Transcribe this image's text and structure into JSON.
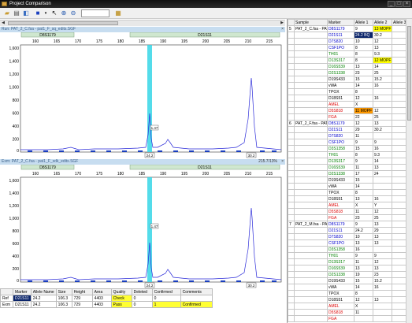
{
  "window": {
    "title": "Project Comparison"
  },
  "toolbar": {
    "zoom_value": ""
  },
  "plot1": {
    "header": "Run: PAT_2_C.fsa - pat1_F_sq_edits.SGF",
    "marker_labels": [
      "D8S1179",
      "D21S11"
    ],
    "x_ticks": [
      "160",
      "165",
      "170",
      "175",
      "180",
      "185",
      "190",
      "195",
      "200",
      "205",
      "210",
      "215"
    ],
    "y_ticks": [
      "1,600",
      "1,400",
      "1,200",
      "1,000",
      "800",
      "600",
      "400",
      "200",
      "0"
    ],
    "peak_label": "1.47",
    "allele_labels": [
      "24.2",
      "30.2"
    ]
  },
  "plot2": {
    "header": "Exm: PAT_2_C.fsa - pat1_F_sdk_edits.SGF",
    "header_right": "215.7/13%",
    "marker_labels": [
      "D8S1179",
      "D21S11"
    ],
    "x_ticks": [
      "160",
      "165",
      "170",
      "175",
      "180",
      "185",
      "190",
      "195",
      "200",
      "205",
      "210",
      "215"
    ],
    "y_ticks": [
      "1,600",
      "1,400",
      "1,200",
      "1,000",
      "800",
      "600",
      "400",
      "200",
      "0"
    ],
    "peak_label": "1.47",
    "allele_labels": [
      "24.2",
      "30.2"
    ]
  },
  "bottom_table": {
    "headers": [
      "",
      "Marker",
      "Allele Name",
      "Size",
      "Height",
      "Area",
      "Quality",
      "Deleted",
      "Confirmed",
      "Comments"
    ],
    "rows": [
      [
        "Ref",
        "D21S11",
        "24.2",
        "106.3",
        "729",
        "4403",
        "Check",
        "0",
        "0",
        ""
      ],
      [
        "Exm",
        "D21S11",
        "24.2",
        "106.3",
        "729",
        "4403",
        "Pass",
        "0",
        "1",
        "Confirmed"
      ]
    ]
  },
  "right_table": {
    "headers": [
      "",
      "Sample",
      "Marker",
      "Allele 1",
      "Allele 2",
      "Allele 3"
    ],
    "groups": [
      {
        "num": "5",
        "sample": "PAT_2_C.fsa - PAT",
        "rows": [
          {
            "m": "D8S1179",
            "c": "#0000cc",
            "a1": "9",
            "a2": "13 MOPF",
            "a2bg": "#ffff00"
          },
          {
            "m": "D21S11",
            "c": "#0000cc",
            "a1": "24.2 BQ",
            "a1bg": "#0a246a",
            "a1c": "#ffffff",
            "a2": "30.2"
          },
          {
            "m": "D7S820",
            "c": "#0000cc",
            "a1": "10",
            "a2": "12"
          },
          {
            "m": "CSF1PO",
            "c": "#0000cc",
            "a1": "8",
            "a2": "13"
          },
          {
            "m": "TH01",
            "c": "#008000",
            "a1": "8",
            "a2": "9.3"
          },
          {
            "m": "D13S317",
            "c": "#008000",
            "a1": "8",
            "a2": "12 MOPF",
            "a2bg": "#ffff00"
          },
          {
            "m": "D16S539",
            "c": "#008000",
            "a1": "13",
            "a2": "14"
          },
          {
            "m": "D2S1338",
            "c": "#008000",
            "a1": "23",
            "a2": "25"
          },
          {
            "m": "D19S433",
            "c": "#000000",
            "a1": "15",
            "a2": "15.2"
          },
          {
            "m": "vWA",
            "c": "#000000",
            "a1": "14",
            "a2": "16"
          },
          {
            "m": "TPOX",
            "c": "#000000",
            "a1": "8",
            "a2": ""
          },
          {
            "m": "D18S51",
            "c": "#000000",
            "a1": "12",
            "a2": "16"
          },
          {
            "m": "AMEL",
            "c": "#dd0000",
            "a1": "X",
            "a2": ""
          },
          {
            "m": "D5S818",
            "c": "#dd0000",
            "a1": "11 MOPF",
            "a1bg": "#ff9900",
            "a2": "12"
          },
          {
            "m": "FGA",
            "c": "#dd0000",
            "a1": "22",
            "a2": "25"
          }
        ]
      },
      {
        "num": "6",
        "sample": "PAT_2_F.fsa - PAT",
        "rows": [
          {
            "m": "D8S1179",
            "c": "#0000cc",
            "a1": "12",
            "a2": "13"
          },
          {
            "m": "D21S11",
            "c": "#0000cc",
            "a1": "29",
            "a2": "30.2"
          },
          {
            "m": "D7S820",
            "c": "#0000cc",
            "a1": "11",
            "a2": ""
          },
          {
            "m": "CSF1PO",
            "c": "#0000cc",
            "a1": "9",
            "a2": "9"
          },
          {
            "m": "D3S1358",
            "c": "#008000",
            "a1": "15",
            "a2": "16"
          },
          {
            "m": "TH01",
            "c": "#008000",
            "a1": "8",
            "a2": "9.3"
          },
          {
            "m": "D13S317",
            "c": "#008000",
            "a1": "9",
            "a2": "14"
          },
          {
            "m": "D16S539",
            "c": "#008000",
            "a1": "11",
            "a2": "13"
          },
          {
            "m": "D2S1338",
            "c": "#008000",
            "a1": "17",
            "a2": "24"
          },
          {
            "m": "D19S433",
            "c": "#000000",
            "a1": "15",
            "a2": ""
          },
          {
            "m": "vWA",
            "c": "#000000",
            "a1": "14",
            "a2": ""
          },
          {
            "m": "TPOX",
            "c": "#000000",
            "a1": "8",
            "a2": ""
          },
          {
            "m": "D18S51",
            "c": "#000000",
            "a1": "13",
            "a2": "16"
          },
          {
            "m": "AMEL",
            "c": "#dd0000",
            "a1": "X",
            "a2": "Y"
          },
          {
            "m": "D5S818",
            "c": "#dd0000",
            "a1": "11",
            "a2": "12"
          },
          {
            "m": "FGA",
            "c": "#dd0000",
            "a1": "23",
            "a2": "25"
          }
        ]
      },
      {
        "num": "7",
        "sample": "PAT_2_M.fsa - PAT",
        "rows": [
          {
            "m": "D8S1179",
            "c": "#0000cc",
            "a1": "9",
            "a2": "13"
          },
          {
            "m": "D21S11",
            "c": "#0000cc",
            "a1": "24.2",
            "a2": "29"
          },
          {
            "m": "D7S820",
            "c": "#0000cc",
            "a1": "10",
            "a2": "13"
          },
          {
            "m": "CSF1PO",
            "c": "#0000cc",
            "a1": "13",
            "a2": "13"
          },
          {
            "m": "D3S1358",
            "c": "#008000",
            "a1": "16",
            "a2": ""
          },
          {
            "m": "TH01",
            "c": "#008000",
            "a1": "9",
            "a2": "9"
          },
          {
            "m": "D13S317",
            "c": "#008000",
            "a1": "11",
            "a2": "12"
          },
          {
            "m": "D16S539",
            "c": "#008000",
            "a1": "13",
            "a2": "13"
          },
          {
            "m": "D2S1338",
            "c": "#008000",
            "a1": "19",
            "a2": "23"
          },
          {
            "m": "D19S433",
            "c": "#000000",
            "a1": "15",
            "a2": "15.2"
          },
          {
            "m": "vWA",
            "c": "#000000",
            "a1": "14",
            "a2": "16"
          },
          {
            "m": "TPOX",
            "c": "#000000",
            "a1": "8",
            "a2": ""
          },
          {
            "m": "D18S51",
            "c": "#000000",
            "a1": "12",
            "a2": "13"
          },
          {
            "m": "AMEL",
            "c": "#dd0000",
            "a1": "X",
            "a2": ""
          },
          {
            "m": "D5S818",
            "c": "#dd0000",
            "a1": "11",
            "a2": ""
          },
          {
            "m": "FGA",
            "c": "#dd0000",
            "a1": "",
            "a2": ""
          }
        ]
      }
    ]
  }
}
